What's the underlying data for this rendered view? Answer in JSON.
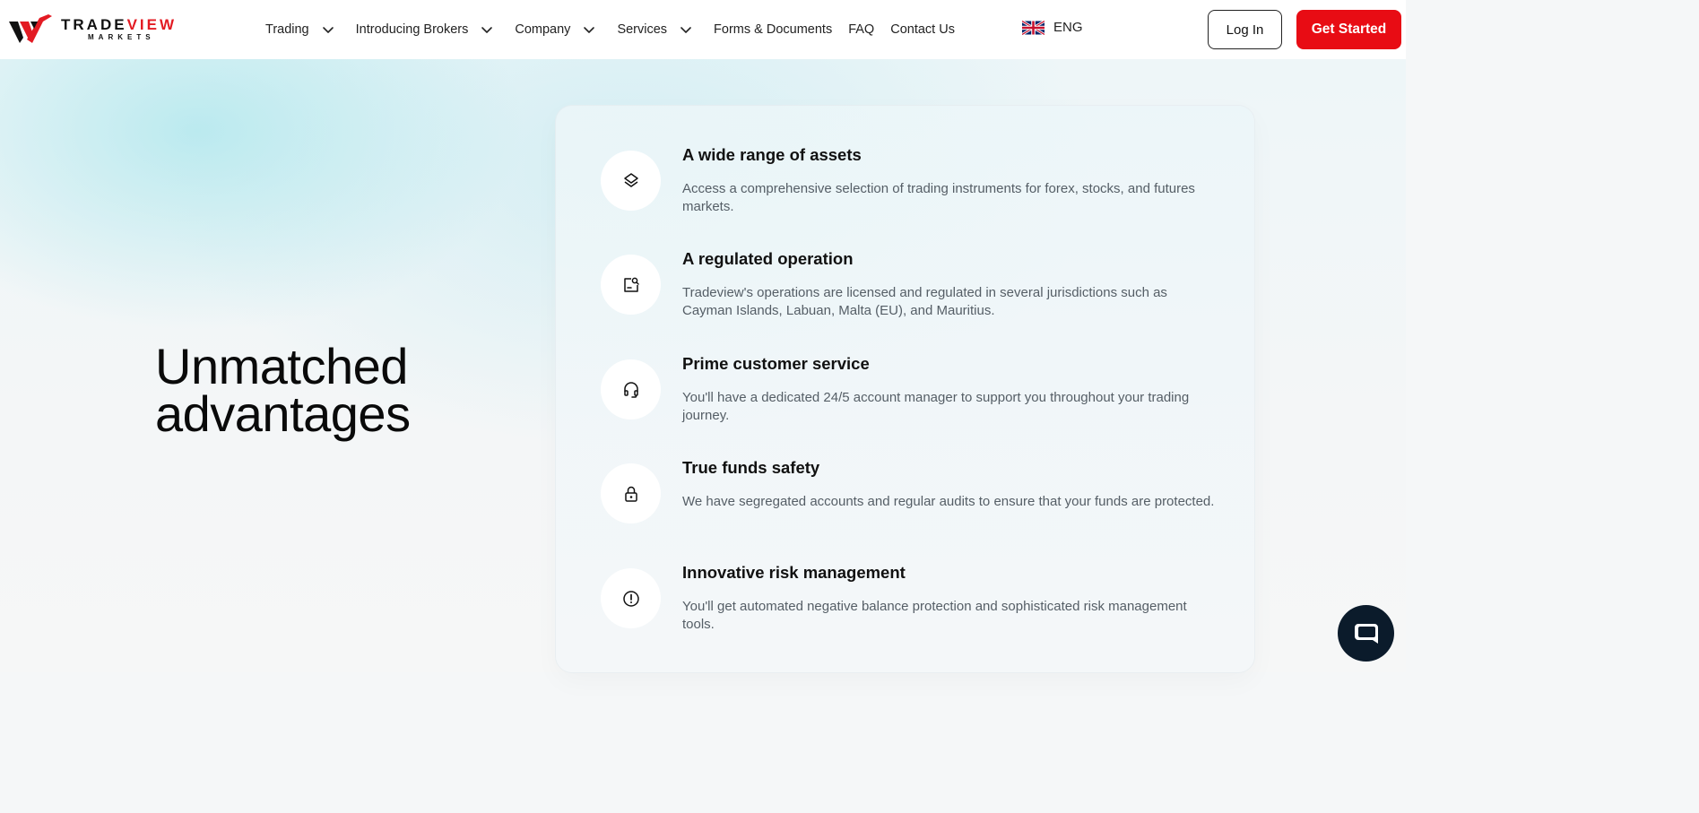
{
  "header": {
    "logo": {
      "word_black": "TRADE",
      "word_red": "VIEW",
      "sub": "MARKETS"
    },
    "nav": [
      {
        "label": "Trading",
        "has_dropdown": true
      },
      {
        "label": "Introducing Brokers",
        "has_dropdown": true
      },
      {
        "label": "Company",
        "has_dropdown": true
      },
      {
        "label": "Services",
        "has_dropdown": true
      },
      {
        "label": "Forms & Documents",
        "has_dropdown": false
      },
      {
        "label": "FAQ",
        "has_dropdown": false
      },
      {
        "label": "Contact Us",
        "has_dropdown": false
      }
    ],
    "language": {
      "label": "ENG",
      "flag_icon": "uk-flag-icon"
    },
    "login_label": "Log In",
    "cta_label": "Get Started"
  },
  "hero": {
    "title_line1": "Unmatched",
    "title_line2": "advantages"
  },
  "features": [
    {
      "icon": "layers-icon",
      "title": "A wide range of assets",
      "description": "Access a comprehensive selection of trading instruments for forex, stocks, and futures markets."
    },
    {
      "icon": "regulated-document-icon",
      "title": "A regulated operation",
      "description": "Tradeview's operations are licensed and regulated in several jurisdictions such as Cayman Islands, Labuan, Malta (EU), and Mauritius."
    },
    {
      "icon": "headset-icon",
      "title": "Prime customer service",
      "description": "You'll have a dedicated 24/5 account manager to support you throughout your trading journey."
    },
    {
      "icon": "lock-icon",
      "title": "True funds safety",
      "description": "We have segregated accounts and regular audits to ensure that your funds are protected."
    },
    {
      "icon": "alert-circle-icon",
      "title": "Innovative risk management",
      "description": "You'll get automated negative balance protection and sophisticated risk management tools."
    }
  ],
  "colors": {
    "brand_red": "#e80c14",
    "chat_bg": "#0b1b2b",
    "text_dark": "#111111",
    "text_muted": "#555e66"
  },
  "chat_widget": {
    "icon": "chat-bubble-icon"
  }
}
